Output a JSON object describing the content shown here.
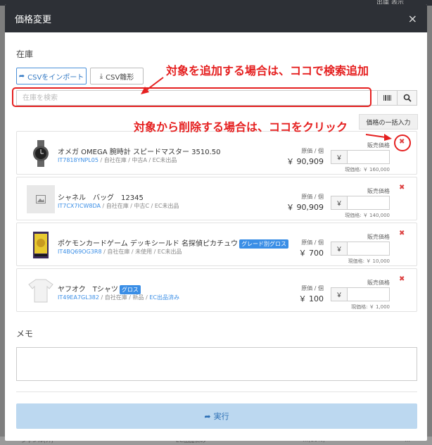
{
  "background": {
    "top_text": "出庫 表示",
    "bottom": [
      "ジャンル(ｿｹ)",
      "EC出品済み",
      "…(10%)",
      "…"
    ]
  },
  "modal": {
    "title": "価格変更",
    "close_icon": "close-icon"
  },
  "stock": {
    "label": "在庫",
    "import_button": "CSVをインポート",
    "template_button": "CSV雛形",
    "search_placeholder": "在庫を検索",
    "bulk_button": "価格の一括入力"
  },
  "annotations": {
    "add_text": "対象を追加する場合は、ココで検索追加",
    "remove_text": "対象から削除する場合は、ココをクリック",
    "color": "#e52020"
  },
  "items": [
    {
      "name": "オメガ OMEGA 腕時計 スピードマスター 3510.50",
      "tag": "",
      "code": "IT7818YNPL05",
      "meta": " / 自社在庫 / 中古A / EC未出品",
      "meta_link": "",
      "cost_label": "原価 / 個",
      "cost": "￥ 90,909",
      "price_label": "販売価格",
      "yen": "￥",
      "current_price": "現価格: ￥ 160,000",
      "thumb": "watch"
    },
    {
      "name": "シャネル　バッグ　12345",
      "tag": "",
      "code": "IT7CX7ICW8DA",
      "meta": " / 自社在庫 / 中古C / EC未出品",
      "meta_link": "",
      "cost_label": "原価 / 個",
      "cost": "￥ 90,909",
      "price_label": "販売価格",
      "yen": "￥",
      "current_price": "現価格: ￥ 140,000",
      "thumb": "placeholder"
    },
    {
      "name": "ポケモンカードゲーム デッキシールド 名探偵ピカチュウ",
      "tag": "グレード別グロス",
      "code": "IT4BQ69OG3R8",
      "meta": " / 自社在庫 / 未使用 / EC未出品",
      "meta_link": "",
      "cost_label": "原価 / 個",
      "cost": "￥ 700",
      "price_label": "販売価格",
      "yen": "￥",
      "current_price": "現価格: ￥ 10,000",
      "thumb": "card"
    },
    {
      "name": "ヤフオク　Tシャツ",
      "tag": "グロス",
      "code": "IT49EA7GL382",
      "meta": " / 自社在庫 / 新品 / ",
      "meta_link": "EC出品済み",
      "cost_label": "原価 / 個",
      "cost": "￥ 100",
      "price_label": "販売価格",
      "yen": "￥",
      "current_price": "現価格: ￥ 1,000",
      "thumb": "shirt"
    }
  ],
  "memo_label": "メモ",
  "submit_label": "実行"
}
